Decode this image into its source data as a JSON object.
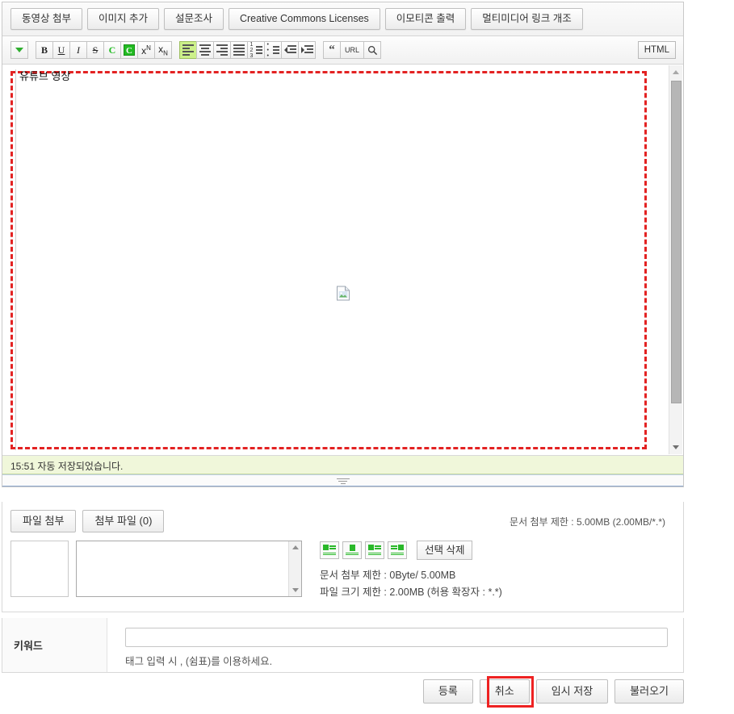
{
  "plugin_bar": {
    "buttons": [
      {
        "label": "동영상 첨부",
        "name": "attach-video-button"
      },
      {
        "label": "이미지 추가",
        "name": "add-image-button"
      },
      {
        "label": "설문조사",
        "name": "survey-button"
      },
      {
        "label": "Creative Commons Licenses",
        "name": "cc-licenses-button"
      },
      {
        "label": "이모티콘 출력",
        "name": "emoticon-button"
      },
      {
        "label": "멀티미디어 링크 개조",
        "name": "multimedia-link-button"
      }
    ]
  },
  "format_bar": {
    "expand_icon": "chevron-down-icon",
    "bold": "B",
    "underline": "U",
    "italic": "I",
    "strike": "S",
    "font_color": "C",
    "back_color": "C",
    "url_label": "URL",
    "html_label": "HTML"
  },
  "editor": {
    "first_line": "유튜브 영상",
    "image_placeholder": "broken-image-icon"
  },
  "status": {
    "autosave_text": "15:51 자동 저장되었습니다."
  },
  "attachments": {
    "attach_file_label": "파일 첨부",
    "attached_files_label": "첨부 파일 (0)",
    "doc_limit_top": "문서 첨부 제한 : 5.00MB (2.00MB/*.*)",
    "select_delete_label": "선택 삭제",
    "doc_limit_used": "문서 첨부 제한 : 0Byte/ 5.00MB",
    "file_size_limit": "파일 크기 제한 : 2.00MB (허용 확장자 : *.*)"
  },
  "keyword": {
    "label": "키워드",
    "value": "",
    "hint": "태그 입력 시 , (쉼표)를 이용하세요."
  },
  "actions": {
    "submit": "등록",
    "cancel": "취소",
    "save_draft": "임시 저장",
    "load": "불러오기"
  },
  "colors": {
    "highlight_red": "#ee2222",
    "accent_green": "#22bb22",
    "active_toolbar": "#ccf08a",
    "status_bg": "#f0f7da"
  }
}
